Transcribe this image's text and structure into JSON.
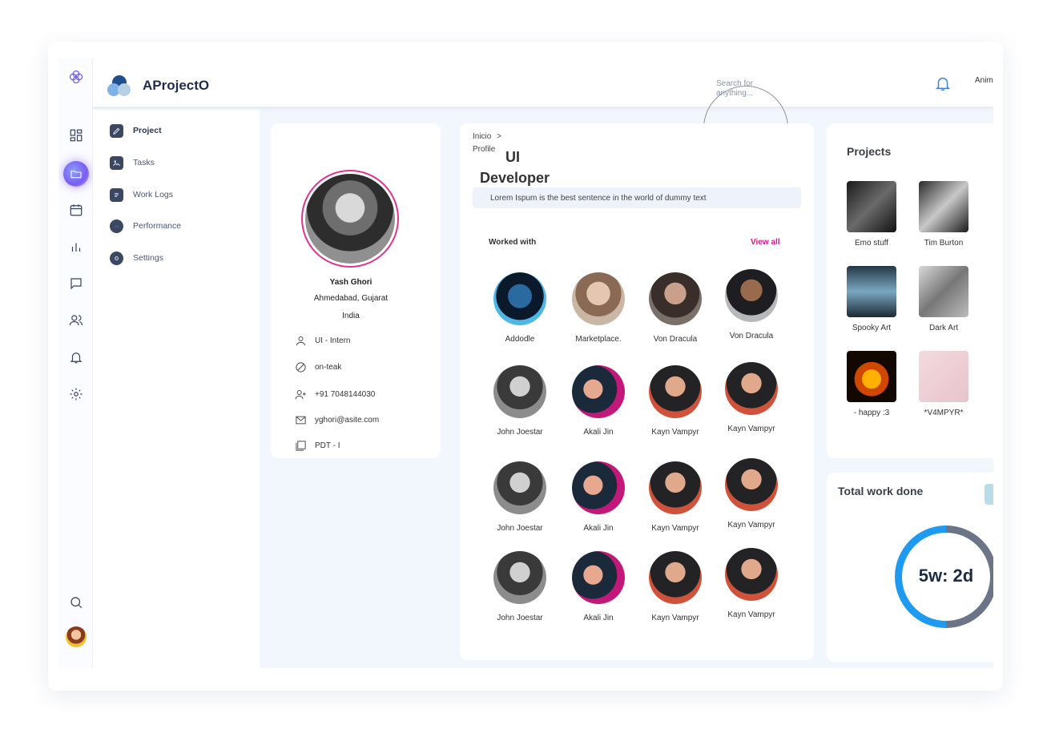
{
  "app": {
    "name": "AProjectO"
  },
  "topbar": {
    "search_placeholder": "Search for anything...",
    "user_name": "Anim"
  },
  "sidebar": {
    "items": [
      {
        "label": "Project",
        "icon": "pencil-icon"
      },
      {
        "label": "Tasks",
        "icon": "image-icon"
      },
      {
        "label": "Work Logs",
        "icon": "document-icon"
      },
      {
        "label": "Performance",
        "icon": "chat-bubble-icon"
      },
      {
        "label": "Settings",
        "icon": "gear-icon"
      }
    ]
  },
  "profile": {
    "name": "Yash Ghori",
    "location_line1": "Ahmedabad, Gujarat",
    "location_line2": "India",
    "role": "UI - Intern",
    "status": "on-teak",
    "phone": "+91 7048144030",
    "email": "yghori@asite.com",
    "department": "PDT - I"
  },
  "main": {
    "breadcrumb_home": "Inicio",
    "breadcrumb_sep": ">",
    "breadcrumb_current": "Profile",
    "title_line1": "UI",
    "title_line2": "Developer",
    "tagline": "Lorem Ispum is the best sentence in the world of dummy text",
    "worked_with_title": "Worked with",
    "view_all": "View all",
    "people": [
      "Addodle",
      "Marketplace.",
      "Von Dracula",
      "Von Dracula",
      "John Joestar",
      "Akali Jin",
      "Kayn Vampyr",
      "Kayn Vampyr",
      "John Joestar",
      "Akali Jin",
      "Kayn Vampyr",
      "Kayn Vampyr",
      "John Joestar",
      "Akali Jin",
      "Kayn Vampyr",
      "Kayn Vampyr"
    ]
  },
  "projects": {
    "title": "Projects",
    "items": [
      "Emo stuff",
      "Tim Burton",
      "Spooky Art",
      "Dark Art",
      "- happy :3",
      "*V4MPYR*"
    ]
  },
  "work": {
    "title": "Total work done",
    "value": "5w: 2d",
    "progress_fraction": 0.5
  },
  "colors": {
    "accent_pink": "#d6168b",
    "ring_blue": "#1e9bf0",
    "ring_gray": "#6c7487",
    "brand_dark": "#1f2d4d"
  }
}
